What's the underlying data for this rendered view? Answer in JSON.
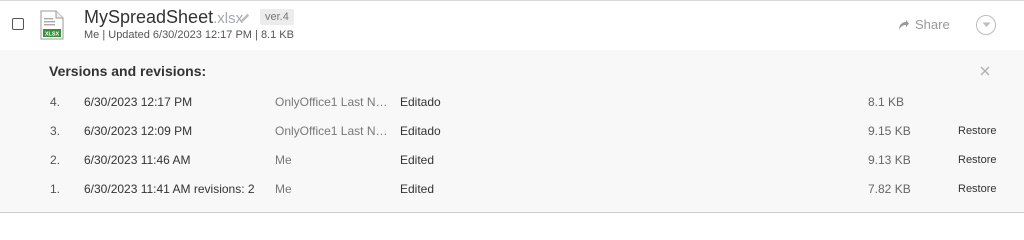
{
  "file": {
    "name": "MySpreadSheet",
    "extension": ".xlsx",
    "version_badge": "ver.4",
    "meta": "Me | Updated 6/30/2023 12:17 PM | 8.1 KB",
    "icon_label": "XLSX",
    "share_label": "Share"
  },
  "versions_panel": {
    "title": "Versions and revisions:",
    "rows": [
      {
        "num": "4.",
        "date": "6/30/2023 12:17 PM",
        "author": "OnlyOffice1 Last N…",
        "comment": "Editado",
        "size": "8.1 KB",
        "restore": ""
      },
      {
        "num": "3.",
        "date": "6/30/2023 12:09 PM",
        "author": "OnlyOffice1 Last N…",
        "comment": "Editado",
        "size": "9.15 KB",
        "restore": "Restore"
      },
      {
        "num": "2.",
        "date": "6/30/2023 11:46 AM",
        "author": "Me",
        "comment": "Edited",
        "size": "9.13 KB",
        "restore": "Restore"
      },
      {
        "num": "1.",
        "date": "6/30/2023 11:41 AM revisions: 2",
        "author": "Me",
        "comment": "Edited",
        "size": "7.82 KB",
        "restore": "Restore"
      }
    ]
  },
  "colors": {
    "xlsx_green": "#3a8f3a",
    "panel_bg": "#f8f8f8"
  }
}
